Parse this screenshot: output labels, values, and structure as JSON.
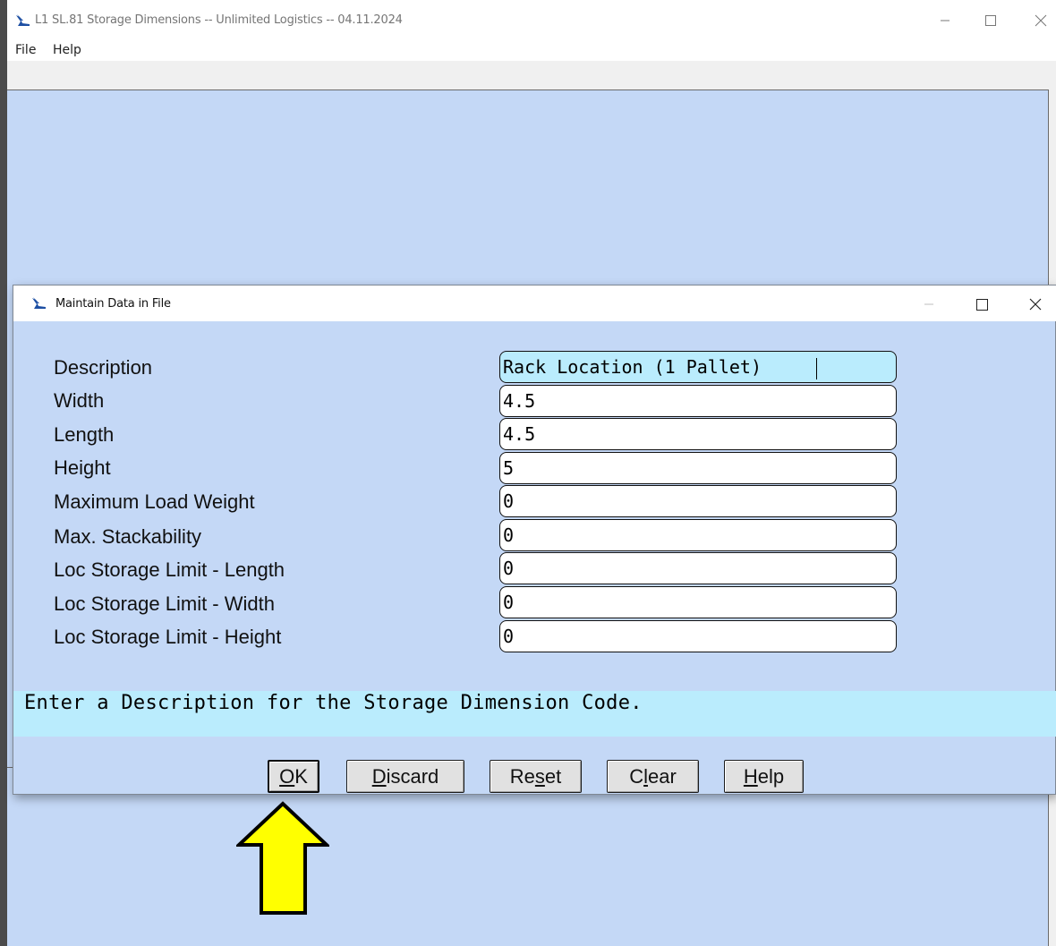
{
  "app": {
    "title": "L1 SL.81 Storage Dimensions -- Unlimited Logistics -- 04.11.2024",
    "menu": [
      "File",
      "Help"
    ],
    "controls": {
      "minimize": "—",
      "maximize": "☐",
      "close": "✕"
    }
  },
  "dialog": {
    "title": "Maintain Data in File",
    "controls": {
      "minimize": "—",
      "maximize": "☐",
      "close": "✕"
    },
    "fields": [
      {
        "label": "Description",
        "value": "Rack Location (1 Pallet)"
      },
      {
        "label": "Width",
        "value": "4.5"
      },
      {
        "label": "Length",
        "value": "4.5"
      },
      {
        "label": "Height",
        "value": "5"
      },
      {
        "label": "Maximum Load Weight",
        "value": "0"
      },
      {
        "label": "Max. Stackability",
        "value": "0"
      },
      {
        "label": "Loc Storage Limit - Length",
        "value": "0"
      },
      {
        "label": "Loc Storage Limit - Width",
        "value": "0"
      },
      {
        "label": "Loc Storage Limit - Height",
        "value": "0"
      }
    ],
    "hint": "Enter a Description for the Storage Dimension Code.",
    "buttons": {
      "ok": {
        "pre": "",
        "mn": "O",
        "post": "K"
      },
      "discard": {
        "pre": "",
        "mn": "D",
        "post": "iscard"
      },
      "reset": {
        "pre": "Re",
        "mn": "s",
        "post": "et"
      },
      "clear": {
        "pre": "C",
        "mn": "l",
        "post": "ear"
      },
      "help": {
        "pre": "",
        "mn": "H",
        "post": "elp"
      }
    }
  },
  "colors": {
    "client_bg": "#c4d8f6",
    "active_field_bg": "#baecfd",
    "hint_bg": "#baecfd",
    "arrow_fill": "#ffff00"
  },
  "annotation": {
    "icon": "arrow-up-icon"
  }
}
